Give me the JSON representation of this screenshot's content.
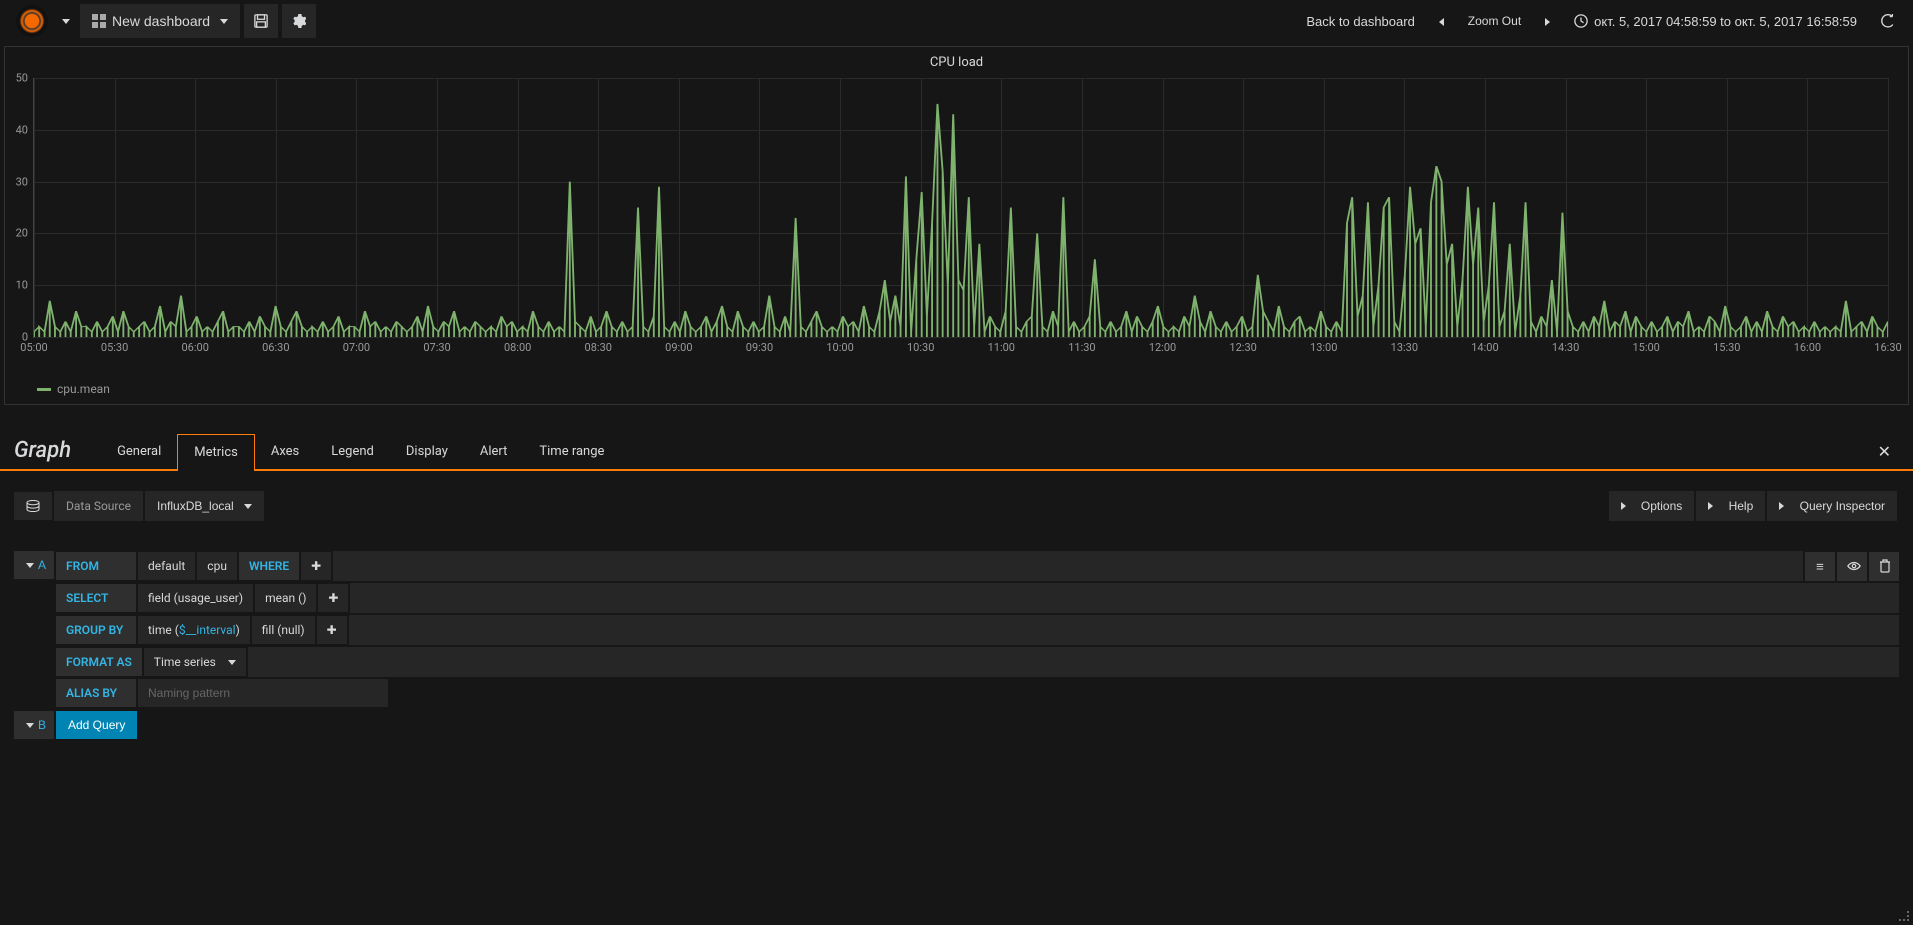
{
  "nav": {
    "dashboard_title": "New dashboard",
    "back_link": "Back to dashboard",
    "zoom_out": "Zoom Out",
    "time_range": "окт. 5, 2017 04:58:59 to окт. 5, 2017 16:58:59"
  },
  "panel": {
    "title": "CPU load",
    "legend_label": "cpu.mean"
  },
  "editor": {
    "title": "Graph",
    "tabs": [
      "General",
      "Metrics",
      "Axes",
      "Legend",
      "Display",
      "Alert",
      "Time range"
    ],
    "active_tab": "Metrics",
    "datasource_label": "Data Source",
    "datasource_value": "InfluxDB_local",
    "options_label": "Options",
    "help_label": "Help",
    "inspector_label": "Query Inspector"
  },
  "query_a": {
    "letter": "A",
    "from_label": "FROM",
    "from_policy": "default",
    "from_measurement": "cpu",
    "where_label": "WHERE",
    "select_label": "SELECT",
    "select_field": "field (usage_user)",
    "select_agg": "mean ()",
    "groupby_label": "GROUP BY",
    "groupby_time_prefix": "time (",
    "groupby_time_var": "$__interval",
    "groupby_time_suffix": ")",
    "groupby_fill": "fill (null)",
    "format_label": "FORMAT AS",
    "format_value": "Time series",
    "alias_label": "ALIAS BY",
    "alias_placeholder": "Naming pattern"
  },
  "query_b": {
    "letter": "B",
    "add_query": "Add Query"
  },
  "chart_data": {
    "type": "line",
    "title": "CPU load",
    "xlabel": "",
    "ylabel": "",
    "ylim": [
      0,
      50
    ],
    "y_ticks": [
      0,
      10,
      20,
      30,
      40,
      50
    ],
    "x_ticks": [
      "05:00",
      "05:30",
      "06:00",
      "06:30",
      "07:00",
      "07:30",
      "08:00",
      "08:30",
      "09:00",
      "09:30",
      "10:00",
      "10:30",
      "11:00",
      "11:30",
      "12:00",
      "12:30",
      "13:00",
      "13:30",
      "14:00",
      "14:30",
      "15:00",
      "15:30",
      "16:00",
      "16:30"
    ],
    "series": [
      {
        "name": "cpu.mean",
        "color": "#7eb26d",
        "values": [
          1,
          2,
          1,
          7,
          2,
          1,
          3,
          1,
          5,
          2,
          2,
          1,
          3,
          1,
          2,
          4,
          1,
          5,
          2,
          1,
          2,
          3,
          1,
          2,
          6,
          1,
          3,
          2,
          8,
          1,
          2,
          4,
          1,
          2,
          1,
          3,
          5,
          1,
          2,
          2,
          1,
          3,
          1,
          4,
          2,
          1,
          6,
          2,
          1,
          3,
          5,
          2,
          1,
          2,
          1,
          3,
          1,
          2,
          4,
          1,
          2,
          2,
          1,
          5,
          2,
          3,
          1,
          2,
          1,
          3,
          2,
          1,
          2,
          4,
          1,
          6,
          2,
          1,
          3,
          2,
          5,
          1,
          2,
          1,
          3,
          2,
          1,
          2,
          1,
          4,
          2,
          3,
          1,
          2,
          1,
          5,
          2,
          1,
          3,
          1,
          2,
          1,
          30,
          3,
          2,
          1,
          4,
          1,
          2,
          5,
          2,
          1,
          3,
          1,
          2,
          25,
          2,
          1,
          4,
          29,
          2,
          1,
          3,
          1,
          5,
          2,
          1,
          2,
          4,
          1,
          3,
          6,
          2,
          1,
          5,
          2,
          1,
          3,
          1,
          2,
          8,
          2,
          1,
          4,
          1,
          23,
          2,
          1,
          3,
          5,
          2,
          1,
          2,
          1,
          4,
          2,
          3,
          1,
          6,
          2,
          1,
          5,
          11,
          3,
          8,
          2,
          31,
          1,
          15,
          28,
          4,
          22,
          45,
          32,
          10,
          43,
          11,
          9,
          27,
          2,
          18,
          1,
          4,
          2,
          1,
          5,
          25,
          2,
          1,
          3,
          4,
          20,
          2,
          1,
          5,
          2,
          27,
          1,
          3,
          1,
          2,
          4,
          15,
          2,
          1,
          3,
          1,
          2,
          5,
          1,
          4,
          2,
          1,
          3,
          6,
          2,
          1,
          2,
          1,
          4,
          2,
          8,
          3,
          1,
          5,
          2,
          1,
          3,
          1,
          2,
          4,
          1,
          2,
          12,
          5,
          3,
          1,
          6,
          2,
          1,
          3,
          4,
          1,
          2,
          1,
          5,
          2,
          1,
          3,
          1,
          22,
          27,
          4,
          8,
          26,
          2,
          10,
          25,
          27,
          3,
          1,
          12,
          29,
          18,
          21,
          2,
          26,
          33,
          30,
          14,
          18,
          2,
          11,
          29,
          14,
          25,
          3,
          10,
          26,
          2,
          5,
          18,
          1,
          8,
          26,
          3,
          1,
          4,
          2,
          11,
          1,
          24,
          5,
          2,
          1,
          3,
          1,
          4,
          2,
          7,
          1,
          3,
          2,
          5,
          1,
          4,
          2,
          1,
          3,
          1,
          2,
          4,
          1,
          3,
          2,
          5,
          1,
          2,
          1,
          4,
          3,
          1,
          6,
          2,
          1,
          2,
          4,
          1,
          3,
          1,
          5,
          2,
          1,
          4,
          2,
          3,
          1,
          2,
          1,
          3,
          1,
          2,
          1,
          2,
          1,
          7,
          1,
          2,
          3,
          1,
          4,
          2,
          1,
          3
        ]
      }
    ]
  }
}
